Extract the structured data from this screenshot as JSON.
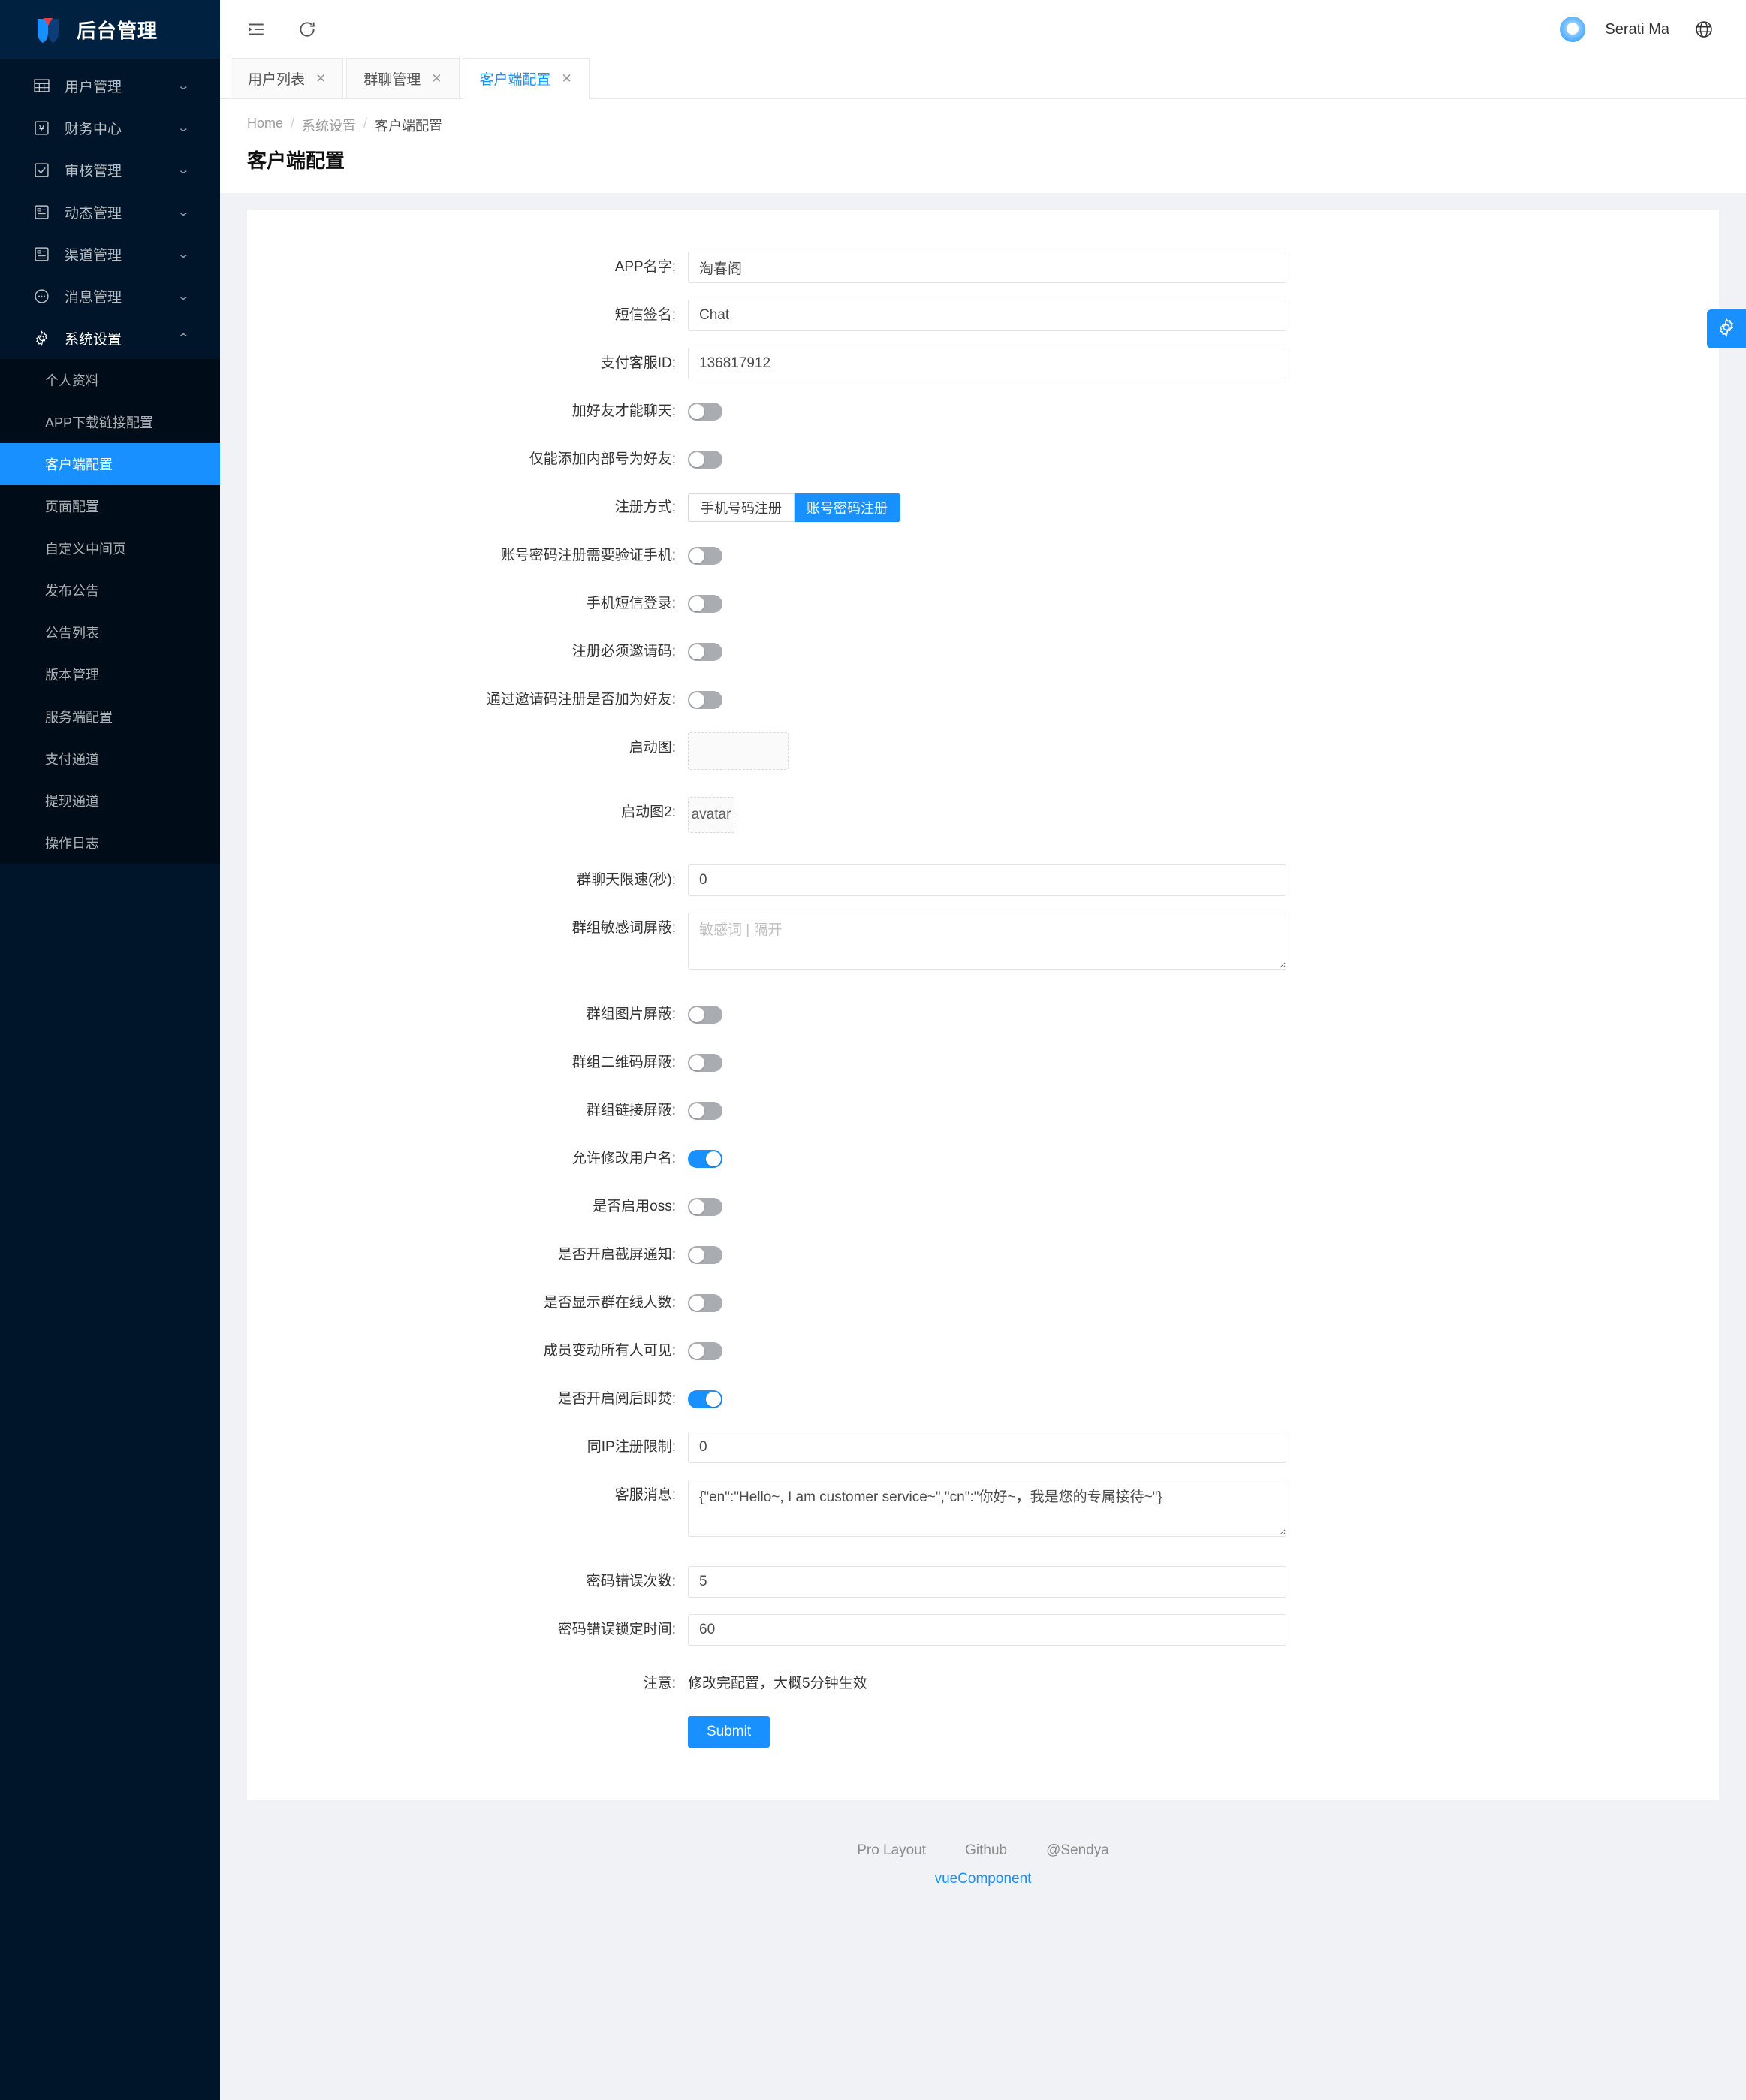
{
  "sidebar": {
    "brand": "后台管理",
    "menu": [
      {
        "label": "用户管理",
        "icon": "table-icon"
      },
      {
        "label": "财务中心",
        "icon": "wallet-icon"
      },
      {
        "label": "审核管理",
        "icon": "check-square-icon"
      },
      {
        "label": "动态管理",
        "icon": "profile-icon"
      },
      {
        "label": "渠道管理",
        "icon": "profile-icon"
      },
      {
        "label": "消息管理",
        "icon": "message-icon"
      },
      {
        "label": "系统设置",
        "icon": "gear-icon"
      }
    ],
    "submenu": [
      "个人资料",
      "APP下载链接配置",
      "客户端配置",
      "页面配置",
      "自定义中间页",
      "发布公告",
      "公告列表",
      "版本管理",
      "服务端配置",
      "支付通道",
      "提现通道",
      "操作日志"
    ],
    "selected_submenu": "客户端配置"
  },
  "header": {
    "collapse_icon": "menu-fold-icon",
    "reload_icon": "reload-icon",
    "user_name": "Serati Ma",
    "language_icon": "globe-icon"
  },
  "tabs": [
    {
      "label": "用户列表",
      "active": false
    },
    {
      "label": "群聊管理",
      "active": false
    },
    {
      "label": "客户端配置",
      "active": true
    }
  ],
  "tab_close_glyph": "✕",
  "breadcrumb": [
    "Home",
    "系统设置",
    "客户端配置"
  ],
  "page_title": "客户端配置",
  "form": {
    "fields": [
      {
        "type": "text",
        "label": "APP名字:",
        "value": "淘春阁",
        "placeholder": ""
      },
      {
        "type": "text",
        "label": "短信签名:",
        "value": "Chat",
        "placeholder": ""
      },
      {
        "type": "text",
        "label": "支付客服ID:",
        "value": "136817912",
        "placeholder": ""
      },
      {
        "type": "switch",
        "label": "加好友才能聊天:",
        "on": false
      },
      {
        "type": "switch",
        "label": "仅能添加内部号为好友:",
        "on": false
      },
      {
        "type": "radio",
        "label": "注册方式:",
        "options": [
          "手机号码注册",
          "账号密码注册"
        ],
        "selected": "账号密码注册"
      },
      {
        "type": "switch",
        "label": "账号密码注册需要验证手机:",
        "on": false
      },
      {
        "type": "switch",
        "label": "手机短信登录:",
        "on": false
      },
      {
        "type": "switch",
        "label": "注册必须邀请码:",
        "on": false
      },
      {
        "type": "switch",
        "label": "通过邀请码注册是否加为好友:",
        "on": false
      },
      {
        "type": "upload-big",
        "label": "启动图:",
        "value": ""
      },
      {
        "type": "upload-small",
        "label": "启动图2:",
        "value": "avatar"
      },
      {
        "type": "text",
        "label": "群聊天限速(秒):",
        "value": "0",
        "placeholder": ""
      },
      {
        "type": "textarea",
        "label": "群组敏感词屏蔽:",
        "value": "",
        "placeholder": "敏感词 | 隔开"
      },
      {
        "type": "switch",
        "label": "群组图片屏蔽:",
        "on": false
      },
      {
        "type": "switch",
        "label": "群组二维码屏蔽:",
        "on": false
      },
      {
        "type": "switch",
        "label": "群组链接屏蔽:",
        "on": false
      },
      {
        "type": "switch",
        "label": "允许修改用户名:",
        "on": true
      },
      {
        "type": "switch",
        "label": "是否启用oss:",
        "on": false
      },
      {
        "type": "switch",
        "label": "是否开启截屏通知:",
        "on": false
      },
      {
        "type": "switch",
        "label": "是否显示群在线人数:",
        "on": false
      },
      {
        "type": "switch",
        "label": "成员变动所有人可见:",
        "on": false
      },
      {
        "type": "switch",
        "label": "是否开启阅后即焚:",
        "on": true
      },
      {
        "type": "text",
        "label": "同IP注册限制:",
        "value": "0",
        "placeholder": ""
      },
      {
        "type": "textarea",
        "label": "客服消息:",
        "value": "{\"en\":\"Hello~, I am customer service~\",\"cn\":\"你好~，我是您的专属接待~\"}",
        "placeholder": ""
      },
      {
        "type": "text",
        "label": "密码错误次数:",
        "value": "5",
        "placeholder": ""
      },
      {
        "type": "text",
        "label": "密码错误锁定时间:",
        "value": "60",
        "placeholder": ""
      }
    ],
    "note_label": "注意:",
    "note_text": "修改完配置，大概5分钟生效",
    "submit_label": "Submit"
  },
  "footer": {
    "links": [
      "Pro Layout",
      "Github",
      "@Sendya"
    ],
    "copyright": "vueComponent"
  },
  "settings_handle_icon": "gear-icon",
  "colors": {
    "primary": "#1890ff",
    "sidebar_bg": "#001529",
    "submenu_bg": "#000c17",
    "page_bg": "#f0f2f5"
  }
}
